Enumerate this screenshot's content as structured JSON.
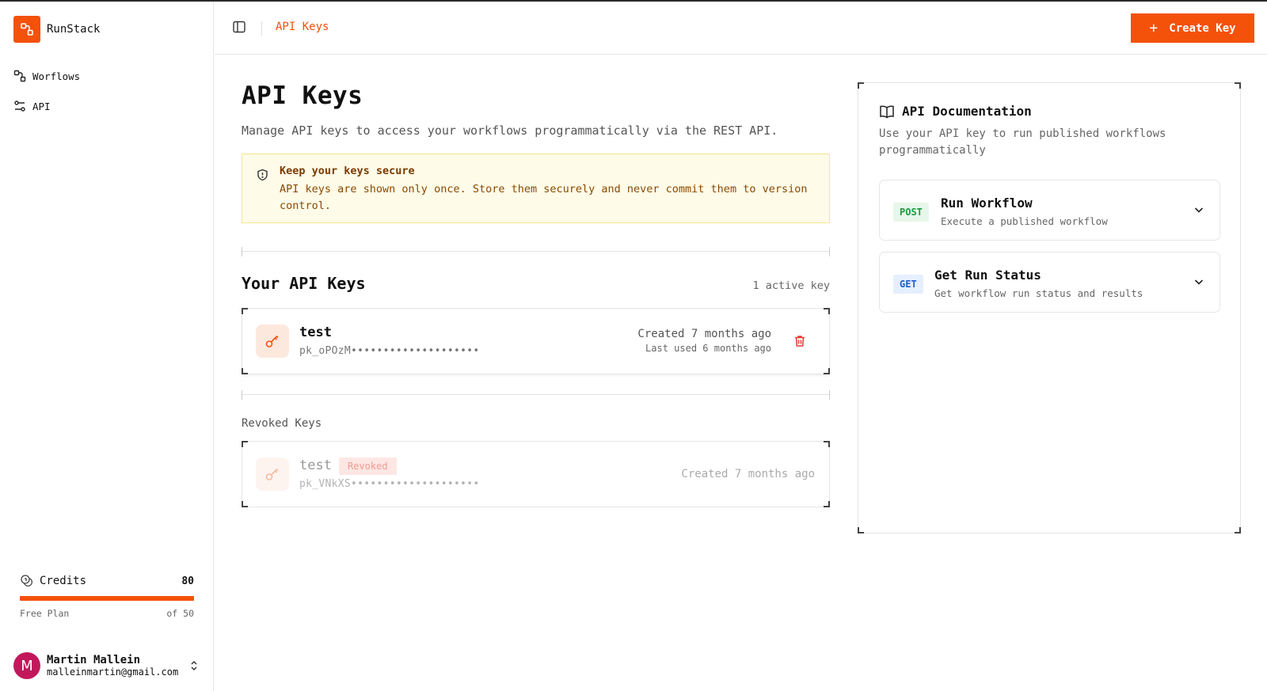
{
  "brand": {
    "name": "RunStack",
    "accent": "#f4510b"
  },
  "sidebar": {
    "items": [
      {
        "label": "Worflows",
        "icon": "workflow-icon"
      },
      {
        "label": "API",
        "icon": "api-icon"
      }
    ],
    "credits": {
      "label": "Credits",
      "value": "80",
      "plan": "Free Plan",
      "of": "of 50",
      "progress_percent": 100
    },
    "user": {
      "initial": "M",
      "name": "Martin Mallein",
      "email": "malleinmartin@gmail.com"
    }
  },
  "header": {
    "breadcrumb": "API Keys",
    "create_label": "Create Key",
    "create_icon": "+"
  },
  "main": {
    "title": "API Keys",
    "description": "Manage API keys to access your workflows programmatically via the REST API.",
    "alert": {
      "title": "Keep your keys secure",
      "text": "API keys are shown only once. Store them securely and never commit them to version control."
    },
    "keys_title": "Your API Keys",
    "keys_count": "1 active key",
    "active_keys": [
      {
        "name": "test",
        "value": "pk_oPOzM••••••••••••••••••••",
        "created": "Created 7 months ago",
        "last_used": "Last used 6 months ago"
      }
    ],
    "revoked_title": "Revoked Keys",
    "revoked_keys": [
      {
        "name": "test",
        "badge": "Revoked",
        "value": "pk_VNkXS••••••••••••••••••••",
        "created": "Created 7 months ago"
      }
    ]
  },
  "docs": {
    "title": "API Documentation",
    "description": "Use your API key to run published workflows programmatically",
    "endpoints": [
      {
        "method": "POST",
        "title": "Run Workflow",
        "subtitle": "Execute a published workflow"
      },
      {
        "method": "GET",
        "title": "Get Run Status",
        "subtitle": "Get workflow run status and results"
      }
    ]
  }
}
